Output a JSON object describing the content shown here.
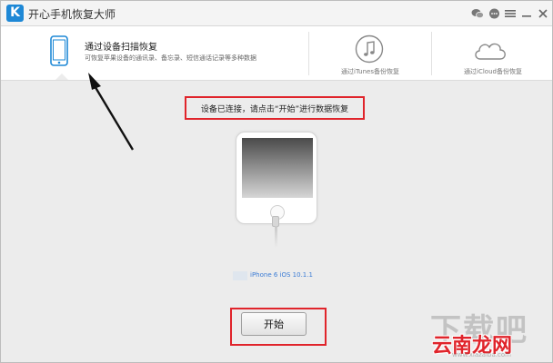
{
  "app": {
    "title": "开心手机恢复大师",
    "logo_letter": "K",
    "accent": "#1e88d6"
  },
  "titlebar_icons": [
    "wechat-icon",
    "chat-icon",
    "menu-icon",
    "minimize-icon",
    "close-icon"
  ],
  "tabs": [
    {
      "title": "通过设备扫描恢复",
      "subtitle": "可恢复苹果设备的通讯录、备忘录、短信通话记录等多种数据",
      "icon": "phone-icon",
      "active": true
    },
    {
      "label": "通过iTunes备份恢复",
      "icon": "music-note-icon",
      "active": false
    },
    {
      "label": "通过iCloud备份恢复",
      "icon": "cloud-icon",
      "active": false
    }
  ],
  "main": {
    "status": "设备已连接，请点击“开始”进行数据恢复",
    "device_info": "iPhone 6 iOS 10.1.1",
    "start_label": "开始"
  },
  "annotations": {
    "highlight_color": "#e0242b"
  },
  "watermark": {
    "big": "下载吧",
    "site": "云南龙网",
    "url": "www.xiazaiba.com"
  }
}
